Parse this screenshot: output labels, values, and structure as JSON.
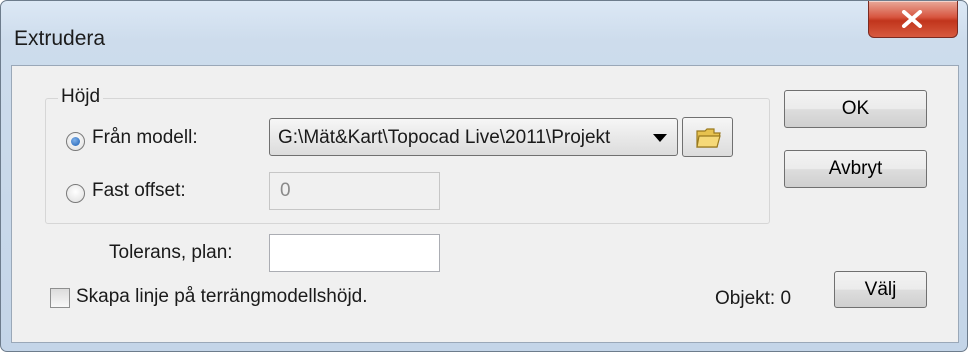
{
  "window": {
    "title": "Extrudera",
    "close_symbol": "X"
  },
  "group": {
    "label": "Höjd",
    "radio_from_model": {
      "label": "Från modell:",
      "checked": true
    },
    "model_path": "G:\\Mät&Kart\\Topocad Live\\2011\\Projekt",
    "radio_fixed_offset": {
      "label": "Fast offset:",
      "checked": false
    },
    "fixed_offset_value": "0"
  },
  "tolerance": {
    "label": "Tolerans, plan:",
    "value": ""
  },
  "checkbox_line": {
    "label": "Skapa linje på terrängmodellshöjd.",
    "checked": false
  },
  "objects": {
    "label": "Objekt: 0"
  },
  "buttons": {
    "ok": "OK",
    "cancel": "Avbryt",
    "select": "Välj"
  },
  "icons": {
    "close": "close-icon",
    "folder": "folder-icon",
    "dropdown": "chevron-down-icon"
  },
  "colors": {
    "titlebar": "#cddcec",
    "client": "#f0f0f0",
    "close_button": "#c7402a"
  }
}
